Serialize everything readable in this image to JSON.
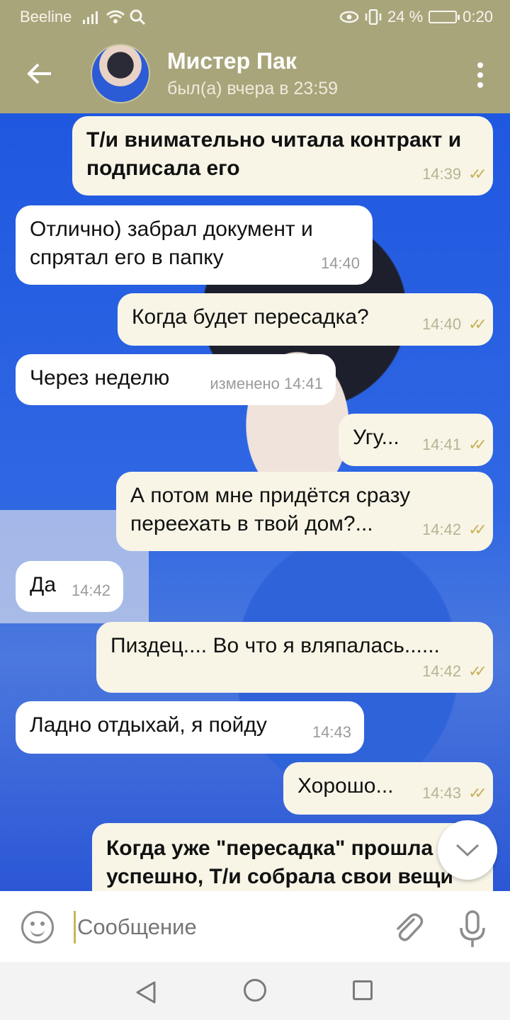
{
  "status_bar": {
    "carrier": "Beeline",
    "battery": "24 %",
    "time": "0:20"
  },
  "header": {
    "back_icon": "arrow-left-icon",
    "contact_name": "Мистер Пак",
    "last_seen": "был(а) вчера в 23:59",
    "menu_icon": "more-vertical-icon"
  },
  "messages": [
    {
      "direction": "out",
      "text": "Т/и внимательно читала контракт и подписала его",
      "time": "14:39",
      "read": true
    },
    {
      "direction": "in",
      "text": "Отлично) забрал документ и спрятал его в папку",
      "time": "14:40"
    },
    {
      "direction": "out",
      "text": "Когда будет пересадка?",
      "time": "14:40",
      "read": true
    },
    {
      "direction": "in",
      "text": "Через неделю",
      "time": "изменено 14:41"
    },
    {
      "direction": "out",
      "text": "Угу...",
      "time": "14:41",
      "read": true
    },
    {
      "direction": "out",
      "text": "А потом мне придётся сразу переехать в твой дом?...",
      "time": "14:42",
      "read": true
    },
    {
      "direction": "in",
      "text": "Да",
      "time": "14:42"
    },
    {
      "direction": "out",
      "text": "Пиздец.... Во что я вляпалась......",
      "time": "14:42",
      "read": true
    },
    {
      "direction": "in",
      "text": "Ладно отдыхай, я пойду",
      "time": "14:43"
    },
    {
      "direction": "out",
      "text": "Хорошо...",
      "time": "14:43",
      "read": true
    },
    {
      "direction": "out",
      "text": "Когда уже \"пересадка\" прошла успешно, Т/и собрала свои вещи",
      "time": "",
      "read": false
    }
  ],
  "composer": {
    "placeholder": "Сообщение",
    "emoji_icon": "smile-icon",
    "attach_icon": "paperclip-icon",
    "mic_icon": "microphone-icon"
  },
  "colors": {
    "header_bg": "#a9a57b",
    "incoming_bubble": "#ffffff",
    "outgoing_bubble": "#f8f5e7",
    "check_color": "#c9b25a"
  }
}
